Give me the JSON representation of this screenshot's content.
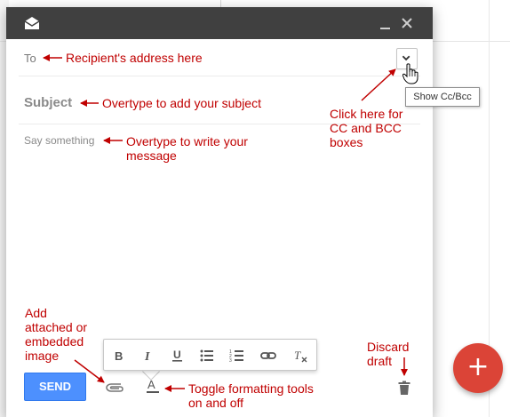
{
  "compose": {
    "to_label": "To",
    "subject_label": "Subject",
    "body_placeholder": "Say something",
    "send_label": "SEND",
    "tooltip": "Show Cc/Bcc"
  },
  "icons": {
    "header": "envelope-open-icon",
    "minimize": "minimize-icon",
    "close": "close-icon",
    "ccbcc": "chevron-down-icon",
    "attach": "paperclip-icon",
    "format": "text-format-icon",
    "discard": "trash-icon",
    "fab": "plus-icon",
    "formatting": [
      "bold-icon",
      "italic-icon",
      "underline-icon",
      "bulleted-list-icon",
      "numbered-list-icon",
      "link-icon",
      "clear-formatting-icon"
    ]
  },
  "fab_label": "+",
  "annotations": {
    "to": "Recipient's address here",
    "subject": "Overtype to add your subject",
    "message_l1": "Overtype to write your",
    "message_l2": "message",
    "ccbcc_l1": "Click here for",
    "ccbcc_l2": "CC and BCC",
    "ccbcc_l3": "boxes",
    "attach_l1": "Add",
    "attach_l2": "attached or",
    "attach_l3": "embedded",
    "attach_l4": "image",
    "discard_l1": "Discard",
    "discard_l2": "draft",
    "toggle_l1": "Toggle formatting tools",
    "toggle_l2": "on and off"
  },
  "colors": {
    "header": "#404040",
    "send": "#4d90fe",
    "fab": "#db4437",
    "annotation": "#c00000"
  }
}
